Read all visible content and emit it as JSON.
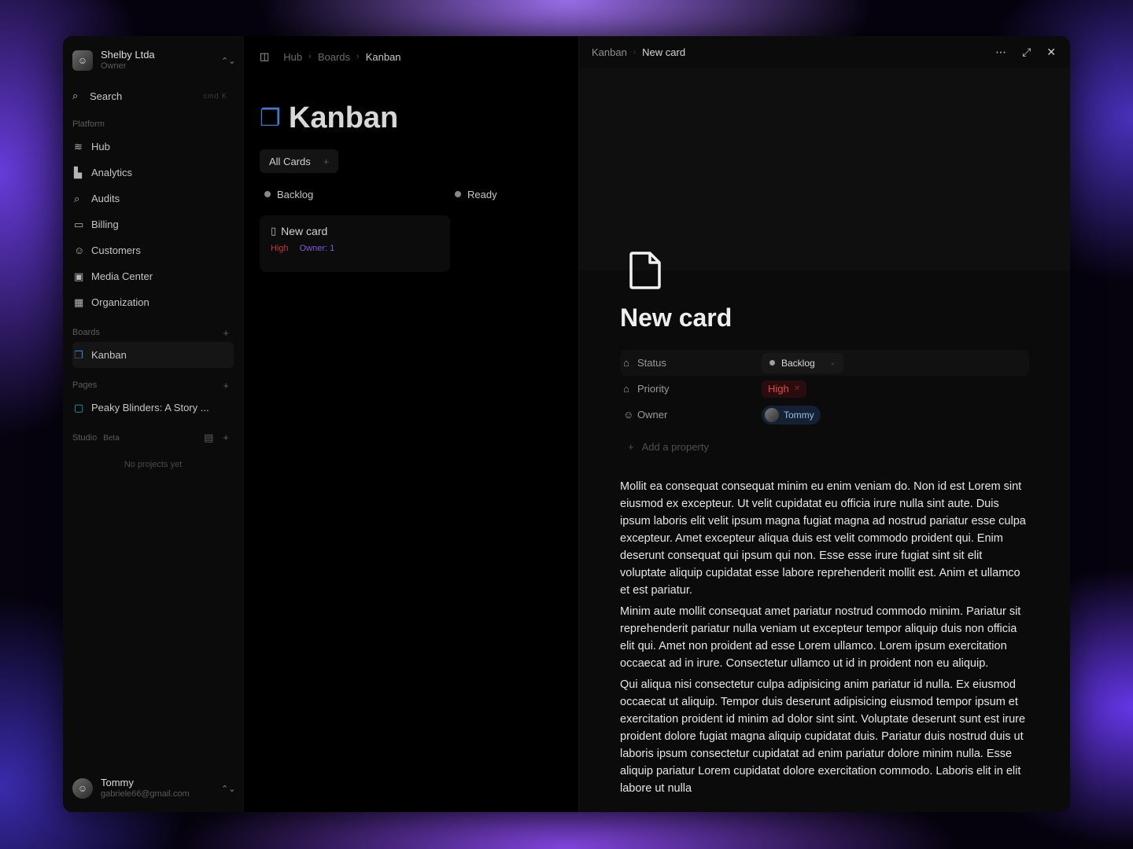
{
  "workspace": {
    "name": "Shelby Ltda",
    "role": "Owner",
    "avatar_icon": "person-photo-icon"
  },
  "search": {
    "label": "Search",
    "shortcut": "cmd K"
  },
  "sidebar": {
    "platform_label": "Platform",
    "platform_items": [
      {
        "label": "Hub",
        "icon": "layers-icon"
      },
      {
        "label": "Analytics",
        "icon": "bar-chart-icon"
      },
      {
        "label": "Audits",
        "icon": "search-doc-icon"
      },
      {
        "label": "Billing",
        "icon": "credit-card-icon"
      },
      {
        "label": "Customers",
        "icon": "users-icon"
      },
      {
        "label": "Media Center",
        "icon": "image-stack-icon"
      },
      {
        "label": "Organization",
        "icon": "building-icon"
      }
    ],
    "boards_label": "Boards",
    "boards_items": [
      {
        "label": "Kanban",
        "icon": "kanban-board-icon"
      }
    ],
    "pages_label": "Pages",
    "pages_items": [
      {
        "label": "Peaky Blinders: A Story ...",
        "icon": "page-icon"
      }
    ],
    "studio_label": "Studio",
    "studio_badge": "Beta",
    "studio_empty": "No projects yet"
  },
  "user": {
    "name": "Tommy",
    "email": "gabriele66@gmail.com"
  },
  "breadcrumb": {
    "items": [
      "Hub",
      "Boards",
      "Kanban"
    ]
  },
  "board": {
    "title": "Kanban",
    "view_tab": "All Cards",
    "columns": [
      {
        "label": "Backlog",
        "dot_color": "#8a8a8a"
      },
      {
        "label": "Ready",
        "dot_color": "#8a8a8a"
      }
    ],
    "card": {
      "title": "New card",
      "priority": "High",
      "owner": "Owner: 1"
    }
  },
  "detail": {
    "breadcrumb_parent": "Kanban",
    "breadcrumb_current": "New card",
    "title": "New card",
    "properties": {
      "status_label": "Status",
      "status_value": "Backlog",
      "priority_label": "Priority",
      "priority_value": "High",
      "owner_label": "Owner",
      "owner_value": "Tommy",
      "add_label": "Add a property"
    },
    "paragraphs": [
      "Mollit ea consequat consequat minim eu enim veniam do. Non id est Lorem sint eiusmod ex excepteur. Ut velit cupidatat eu officia irure nulla sint aute. Duis ipsum laboris elit velit ipsum magna fugiat magna ad nostrud pariatur esse culpa excepteur. Amet excepteur aliqua duis est velit commodo proident qui. Enim deserunt consequat qui ipsum qui non. Esse esse irure fugiat sint sit elit voluptate aliquip cupidatat esse labore reprehenderit mollit est. Anim et ullamco et est pariatur.",
      "Minim aute mollit consequat amet pariatur nostrud commodo minim. Pariatur sit reprehenderit pariatur nulla veniam ut excepteur tempor aliquip duis non officia elit qui. Amet non proident ad esse Lorem ullamco. Lorem ipsum exercitation occaecat ad in irure. Consectetur ullamco ut id in proident non eu aliquip.",
      "Qui aliqua nisi consectetur culpa adipisicing anim pariatur id nulla. Ex eiusmod occaecat ut aliquip. Tempor duis deserunt adipisicing eiusmod tempor ipsum et exercitation proident id minim ad dolor sint sint. Voluptate deserunt sunt est irure proident dolore fugiat magna aliquip cupidatat duis. Pariatur duis nostrud duis ut laboris ipsum consectetur cupidatat ad enim pariatur dolore minim nulla. Esse aliquip pariatur Lorem cupidatat dolore exercitation commodo. Laboris elit in elit labore ut nulla"
    ]
  },
  "colors": {
    "accent_blue": "#4a78c8",
    "priority_red": "#e04a4a",
    "owner_purple": "#7d5cd6"
  }
}
